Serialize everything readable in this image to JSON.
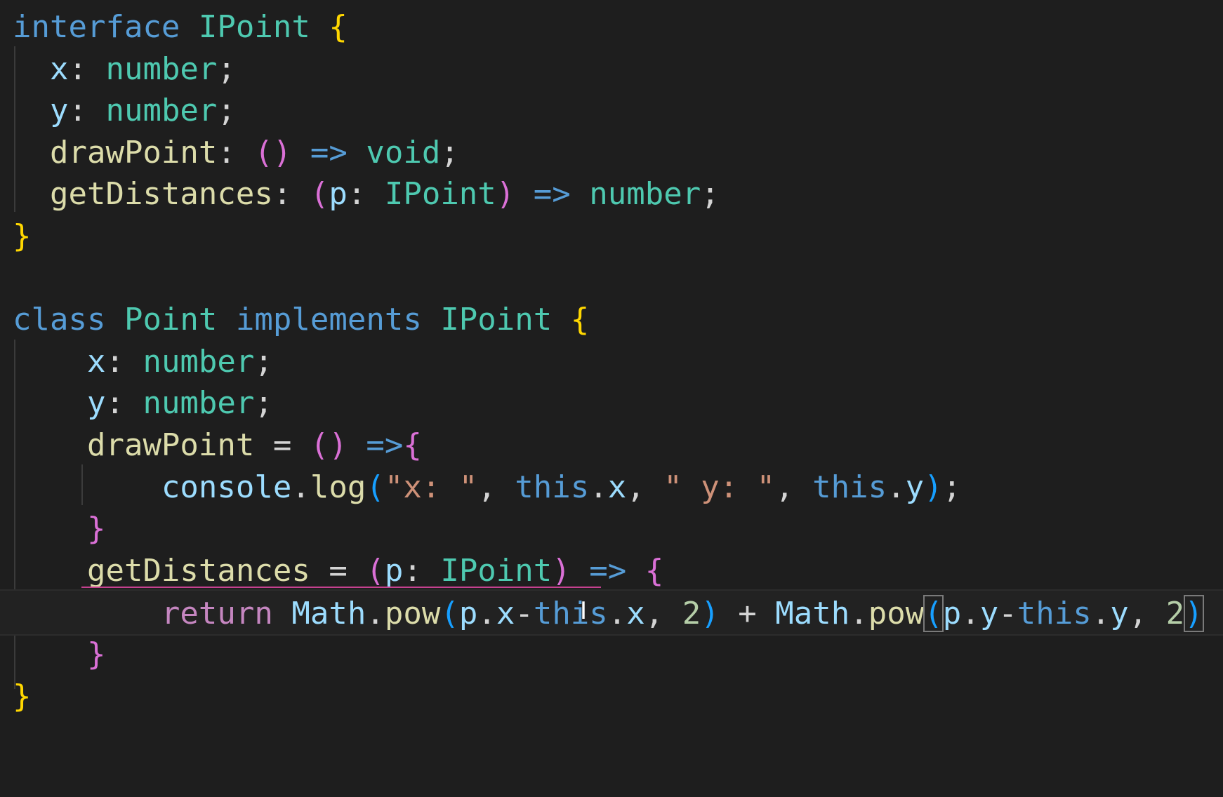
{
  "editor": {
    "language": "TypeScript",
    "theme_background": "#1e1e1e",
    "lines": [
      {
        "tokens": [
          {
            "t": "interface",
            "c": "kw"
          },
          {
            "t": " ",
            "c": "plain"
          },
          {
            "t": "IPoint",
            "c": "type"
          },
          {
            "t": " ",
            "c": "plain"
          },
          {
            "t": "{",
            "c": "b1"
          }
        ]
      },
      {
        "tokens": [
          {
            "t": "  ",
            "c": "plain"
          },
          {
            "t": "x",
            "c": "var"
          },
          {
            "t": ": ",
            "c": "plain"
          },
          {
            "t": "number",
            "c": "type"
          },
          {
            "t": ";",
            "c": "plain"
          }
        ]
      },
      {
        "tokens": [
          {
            "t": "  ",
            "c": "plain"
          },
          {
            "t": "y",
            "c": "var"
          },
          {
            "t": ": ",
            "c": "plain"
          },
          {
            "t": "number",
            "c": "type"
          },
          {
            "t": ";",
            "c": "plain"
          }
        ]
      },
      {
        "tokens": [
          {
            "t": "  ",
            "c": "plain"
          },
          {
            "t": "drawPoint",
            "c": "prop"
          },
          {
            "t": ": ",
            "c": "plain"
          },
          {
            "t": "()",
            "c": "b2"
          },
          {
            "t": " ",
            "c": "plain"
          },
          {
            "t": "=>",
            "c": "kw"
          },
          {
            "t": " ",
            "c": "plain"
          },
          {
            "t": "void",
            "c": "type"
          },
          {
            "t": ";",
            "c": "plain"
          }
        ]
      },
      {
        "tokens": [
          {
            "t": "  ",
            "c": "plain"
          },
          {
            "t": "getDistances",
            "c": "prop"
          },
          {
            "t": ": ",
            "c": "plain"
          },
          {
            "t": "(",
            "c": "b2"
          },
          {
            "t": "p",
            "c": "var"
          },
          {
            "t": ": ",
            "c": "plain"
          },
          {
            "t": "IPoint",
            "c": "type"
          },
          {
            "t": ")",
            "c": "b2"
          },
          {
            "t": " ",
            "c": "plain"
          },
          {
            "t": "=>",
            "c": "kw"
          },
          {
            "t": " ",
            "c": "plain"
          },
          {
            "t": "number",
            "c": "type"
          },
          {
            "t": ";",
            "c": "plain"
          }
        ]
      },
      {
        "tokens": [
          {
            "t": "}",
            "c": "b1"
          }
        ]
      },
      {
        "tokens": []
      },
      {
        "tokens": [
          {
            "t": "class",
            "c": "kw"
          },
          {
            "t": " ",
            "c": "plain"
          },
          {
            "t": "Point",
            "c": "type"
          },
          {
            "t": " ",
            "c": "plain"
          },
          {
            "t": "implements",
            "c": "kw"
          },
          {
            "t": " ",
            "c": "plain"
          },
          {
            "t": "IPoint",
            "c": "type"
          },
          {
            "t": " ",
            "c": "plain"
          },
          {
            "t": "{",
            "c": "b1"
          }
        ]
      },
      {
        "tokens": [
          {
            "t": "    ",
            "c": "plain"
          },
          {
            "t": "x",
            "c": "var"
          },
          {
            "t": ": ",
            "c": "plain"
          },
          {
            "t": "number",
            "c": "type"
          },
          {
            "t": ";",
            "c": "plain"
          }
        ]
      },
      {
        "tokens": [
          {
            "t": "    ",
            "c": "plain"
          },
          {
            "t": "y",
            "c": "var"
          },
          {
            "t": ": ",
            "c": "plain"
          },
          {
            "t": "number",
            "c": "type"
          },
          {
            "t": ";",
            "c": "plain"
          }
        ]
      },
      {
        "tokens": [
          {
            "t": "    ",
            "c": "plain"
          },
          {
            "t": "drawPoint",
            "c": "prop"
          },
          {
            "t": " = ",
            "c": "plain"
          },
          {
            "t": "()",
            "c": "b2"
          },
          {
            "t": " ",
            "c": "plain"
          },
          {
            "t": "=>",
            "c": "kw"
          },
          {
            "t": "{",
            "c": "b2"
          }
        ]
      },
      {
        "tokens": [
          {
            "t": "        ",
            "c": "plain"
          },
          {
            "t": "console",
            "c": "var"
          },
          {
            "t": ".",
            "c": "plain"
          },
          {
            "t": "log",
            "c": "prop"
          },
          {
            "t": "(",
            "c": "b3"
          },
          {
            "t": "\"x: \"",
            "c": "str"
          },
          {
            "t": ", ",
            "c": "plain"
          },
          {
            "t": "this",
            "c": "kw"
          },
          {
            "t": ".",
            "c": "plain"
          },
          {
            "t": "x",
            "c": "var"
          },
          {
            "t": ", ",
            "c": "plain"
          },
          {
            "t": "\" y: \"",
            "c": "str"
          },
          {
            "t": ", ",
            "c": "plain"
          },
          {
            "t": "this",
            "c": "kw"
          },
          {
            "t": ".",
            "c": "plain"
          },
          {
            "t": "y",
            "c": "var"
          },
          {
            "t": ")",
            "c": "b3"
          },
          {
            "t": ";",
            "c": "plain"
          }
        ]
      },
      {
        "tokens": [
          {
            "t": "    ",
            "c": "plain"
          },
          {
            "t": "}",
            "c": "b2"
          }
        ]
      },
      {
        "tokens": [
          {
            "t": "    ",
            "c": "plain"
          },
          {
            "t": "getDistances",
            "c": "prop"
          },
          {
            "t": " = ",
            "c": "plain"
          },
          {
            "t": "(",
            "c": "b2"
          },
          {
            "t": "p",
            "c": "var"
          },
          {
            "t": ": ",
            "c": "plain"
          },
          {
            "t": "IPoint",
            "c": "type"
          },
          {
            "t": ")",
            "c": "b2"
          },
          {
            "t": " ",
            "c": "plain"
          },
          {
            "t": "=>",
            "c": "kw"
          },
          {
            "t": " ",
            "c": "plain"
          },
          {
            "t": "{",
            "c": "b2"
          }
        ]
      },
      {
        "active": true,
        "tokens": [
          {
            "t": "        ",
            "c": "plain"
          },
          {
            "t": "return",
            "c": "ctrl"
          },
          {
            "t": " ",
            "c": "plain"
          },
          {
            "t": "Math",
            "c": "var"
          },
          {
            "t": ".",
            "c": "plain"
          },
          {
            "t": "pow",
            "c": "prop"
          },
          {
            "t": "(",
            "c": "b3"
          },
          {
            "t": "p",
            "c": "var"
          },
          {
            "t": ".",
            "c": "plain"
          },
          {
            "t": "x",
            "c": "var"
          },
          {
            "t": "-",
            "c": "plain"
          },
          {
            "t": "this",
            "c": "kw"
          },
          {
            "t": ".",
            "c": "plain"
          },
          {
            "t": "x",
            "c": "var"
          },
          {
            "t": ", ",
            "c": "plain"
          },
          {
            "t": "2",
            "c": "num"
          },
          {
            "t": ")",
            "c": "b3"
          },
          {
            "t": " + ",
            "c": "plain"
          },
          {
            "t": "Math",
            "c": "var"
          },
          {
            "t": ".",
            "c": "plain"
          },
          {
            "t": "pow",
            "c": "prop"
          },
          {
            "t": "(",
            "c": "b3",
            "match": true
          },
          {
            "t": "p",
            "c": "var"
          },
          {
            "t": ".",
            "c": "plain"
          },
          {
            "t": "y",
            "c": "var"
          },
          {
            "t": "-",
            "c": "plain"
          },
          {
            "t": "this",
            "c": "kw"
          },
          {
            "t": ".",
            "c": "plain"
          },
          {
            "t": "y",
            "c": "var"
          },
          {
            "t": ", ",
            "c": "plain"
          },
          {
            "t": "2",
            "c": "num"
          },
          {
            "t": ")",
            "c": "b3",
            "match": true
          }
        ]
      },
      {
        "tokens": [
          {
            "t": "    ",
            "c": "plain"
          },
          {
            "t": "}",
            "c": "b2"
          }
        ]
      },
      {
        "tokens": [
          {
            "t": "}",
            "c": "b1"
          }
        ]
      }
    ]
  },
  "cursor_glyph": "I"
}
